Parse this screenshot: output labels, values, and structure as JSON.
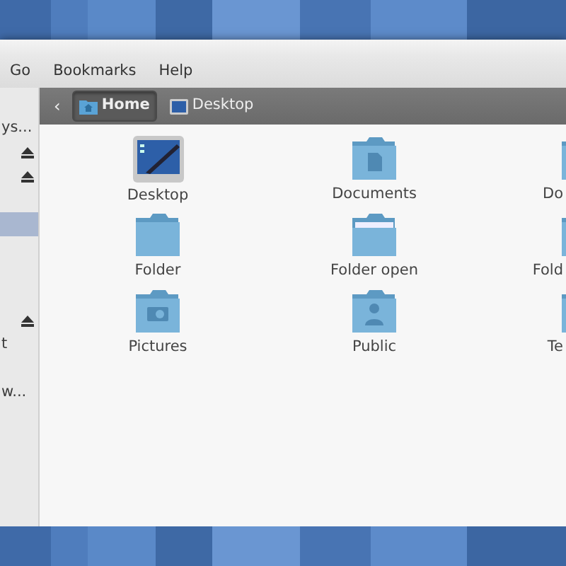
{
  "menu": [
    {
      "label": "Go"
    },
    {
      "label": "Bookmarks"
    },
    {
      "label": "Help"
    }
  ],
  "sidebar": {
    "items": [
      {
        "label": "ys...",
        "eject": false,
        "selected": false
      },
      {
        "eject": true,
        "selected": false
      },
      {
        "eject": true,
        "selected": false
      },
      {
        "eject": false,
        "selected": false
      },
      {
        "eject": false,
        "selected": true
      },
      {
        "eject": false,
        "selected": false
      },
      {
        "eject": false,
        "selected": false
      },
      {
        "eject": false,
        "selected": false
      },
      {
        "eject": true,
        "selected": false
      },
      {
        "label": "t",
        "eject": false,
        "selected": false
      },
      {
        "eject": false,
        "selected": false
      },
      {
        "label": "w...",
        "eject": false,
        "selected": false
      }
    ]
  },
  "pathbar": {
    "back": "‹",
    "crumbs": [
      {
        "label": "Home",
        "kind": "home",
        "selected": true
      },
      {
        "label": "Desktop",
        "kind": "desktop",
        "selected": false
      }
    ]
  },
  "files": [
    {
      "label": "Desktop",
      "kind": "desktop"
    },
    {
      "label": "Documents",
      "kind": "documents"
    },
    {
      "label": "Do",
      "kind": "folder"
    },
    {
      "label": "Folder",
      "kind": "folder"
    },
    {
      "label": "Folder open",
      "kind": "folder-open"
    },
    {
      "label": "Fold",
      "kind": "folder"
    },
    {
      "label": "Pictures",
      "kind": "pictures"
    },
    {
      "label": "Public",
      "kind": "public"
    },
    {
      "label": "Te",
      "kind": "folder"
    }
  ]
}
